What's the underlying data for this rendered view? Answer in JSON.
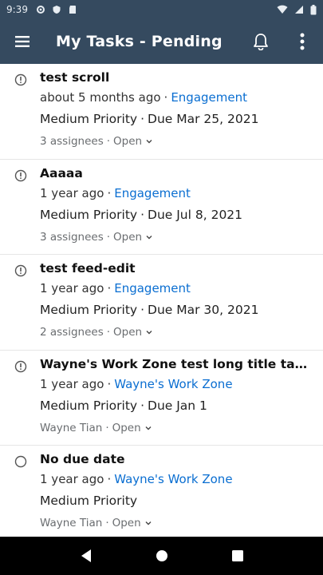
{
  "status_bar": {
    "time": "9:39"
  },
  "app_bar": {
    "title": "My Tasks - Pending"
  },
  "tasks": [
    {
      "title": "test scroll",
      "age": "about 5 months ago",
      "link": "Engagement",
      "priority": "Medium Priority",
      "due": "Due Mar 25, 2021",
      "assignees": "3 assignees",
      "state": "Open",
      "status_icon": "alert-circle-icon"
    },
    {
      "title": "Aaaaa",
      "age": "1 year ago",
      "link": "Engagement",
      "priority": "Medium Priority",
      "due": "Due Jul 8, 2021",
      "assignees": "3 assignees",
      "state": "Open",
      "status_icon": "alert-circle-icon"
    },
    {
      "title": "test feed-edit",
      "age": "1 year ago",
      "link": "Engagement",
      "priority": "Medium Priority",
      "due": "Due Mar 30, 2021",
      "assignees": "2 assignees",
      "state": "Open",
      "status_icon": "alert-circle-icon"
    },
    {
      "title": "Wayne's Work Zone test long title task,S...",
      "age": "1 year ago",
      "link": "Wayne's Work Zone",
      "priority": "Medium Priority",
      "due": "Due Jan 1",
      "assignees": "Wayne Tian",
      "state": "Open",
      "status_icon": "alert-circle-icon"
    },
    {
      "title": "No due date",
      "age": "1 year ago",
      "link": "Wayne's Work Zone",
      "priority": "Medium Priority",
      "due": "",
      "assignees": "Wayne Tian",
      "state": "Open",
      "status_icon": "circle-icon"
    }
  ],
  "colors": {
    "app_bar": "#354a5f",
    "link": "#0a6ed1",
    "nav_bar": "#000000"
  }
}
